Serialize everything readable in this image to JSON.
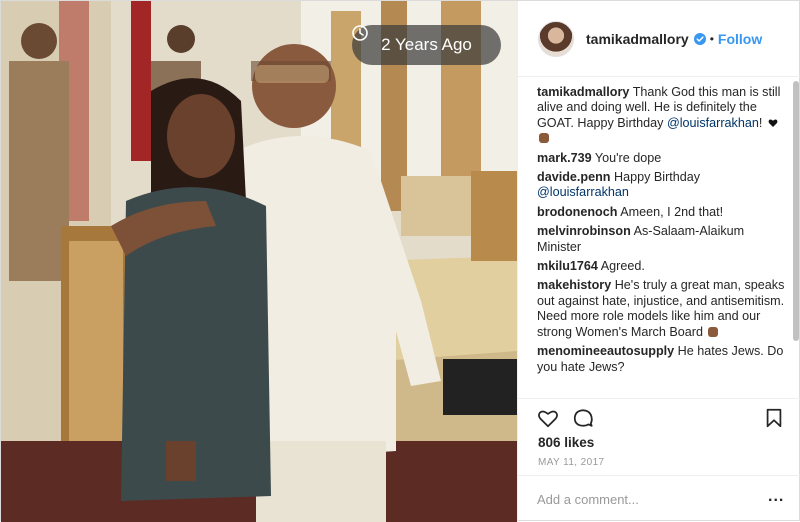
{
  "photo": {
    "time_label": "2 Years Ago",
    "clock_icon": "clock-icon"
  },
  "header": {
    "username": "tamikadmallory",
    "separator": "•",
    "follow_label": "Follow",
    "verified_icon": "verified-badge-icon",
    "accent_color": "#3897f0"
  },
  "comments": [
    {
      "user": "tamikadmallory",
      "text_before": "Thank God this man is still alive and doing well. He is definitely the GOAT. Happy Birthday",
      "mention": "@louisfarrakhan",
      "text_after": "!",
      "emojis": [
        "black-heart-icon",
        "raised-fist-icon"
      ]
    },
    {
      "user": "mark.739",
      "text": "You're dope"
    },
    {
      "user": "davide.penn",
      "text": "Happy Birthday",
      "mention": "@louisfarrakhan"
    },
    {
      "user": "brodonenoch",
      "text": "Ameen, I 2nd that!"
    },
    {
      "user": "melvinrobinson",
      "text": "As-Salaam-Alaikum Minister"
    },
    {
      "user": "mkilu1764",
      "text": "Agreed."
    },
    {
      "user": "makehistory",
      "text": "He's truly a great man, speaks out against hate, injustice, and antisemitism. Need more role models like him and our strong Women's March Board",
      "emojis": [
        "raised-fist-icon"
      ]
    },
    {
      "user": "menomineeautosupply",
      "text": "He hates Jews. Do you hate Jews?"
    }
  ],
  "actions": {
    "like_icon": "heart-icon",
    "comment_icon": "comment-icon",
    "save_icon": "bookmark-icon"
  },
  "likes": "806 likes",
  "date": "MAY 11, 2017",
  "add_comment": {
    "placeholder": "Add a comment...",
    "more_label": "..."
  }
}
